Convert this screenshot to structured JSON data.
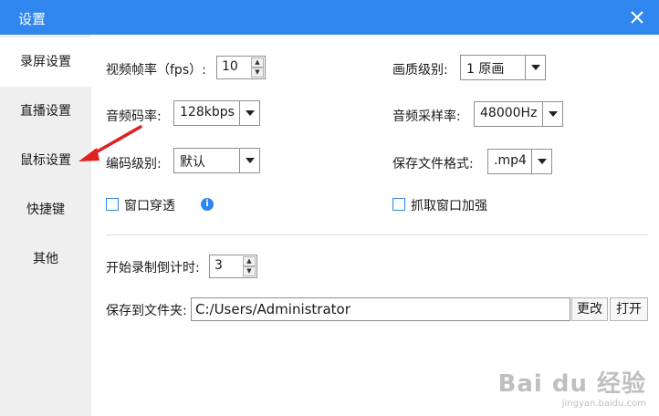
{
  "window": {
    "title": "设置"
  },
  "sidebar": {
    "items": [
      {
        "label": "录屏设置",
        "active": true
      },
      {
        "label": "直播设置"
      },
      {
        "label": "鼠标设置"
      },
      {
        "label": "快捷键"
      },
      {
        "label": "其他"
      }
    ]
  },
  "settings": {
    "fps": {
      "label": "视频帧率（fps）:",
      "value": "10"
    },
    "quality": {
      "label": "画质级别:",
      "value": "1 原画"
    },
    "audio_bitrate": {
      "label": "音频码率:",
      "value": "128kbps"
    },
    "sample_rate": {
      "label": "音频采样率:",
      "value": "48000Hz"
    },
    "encode_level": {
      "label": "编码级别:",
      "value": "默认"
    },
    "file_format": {
      "label": "保存文件格式:",
      "value": ".mp4"
    },
    "window_through": {
      "label": "窗口穿透",
      "checked": false
    },
    "capture_enhance": {
      "label": "抓取窗口加强",
      "checked": false
    },
    "countdown": {
      "label": "开始录制倒计时:",
      "value": "3"
    },
    "save_folder": {
      "label": "保存到文件夹:",
      "value": "C:/Users/Administrator"
    },
    "change_label": "更改",
    "open_label": "打开"
  },
  "watermark": {
    "brand": "Bai du 经验",
    "url": "jingyan.baidu.com"
  },
  "colors": {
    "titlebar": "#2f86ee",
    "sidebar": "#efefef",
    "annotation": "#e02020"
  }
}
